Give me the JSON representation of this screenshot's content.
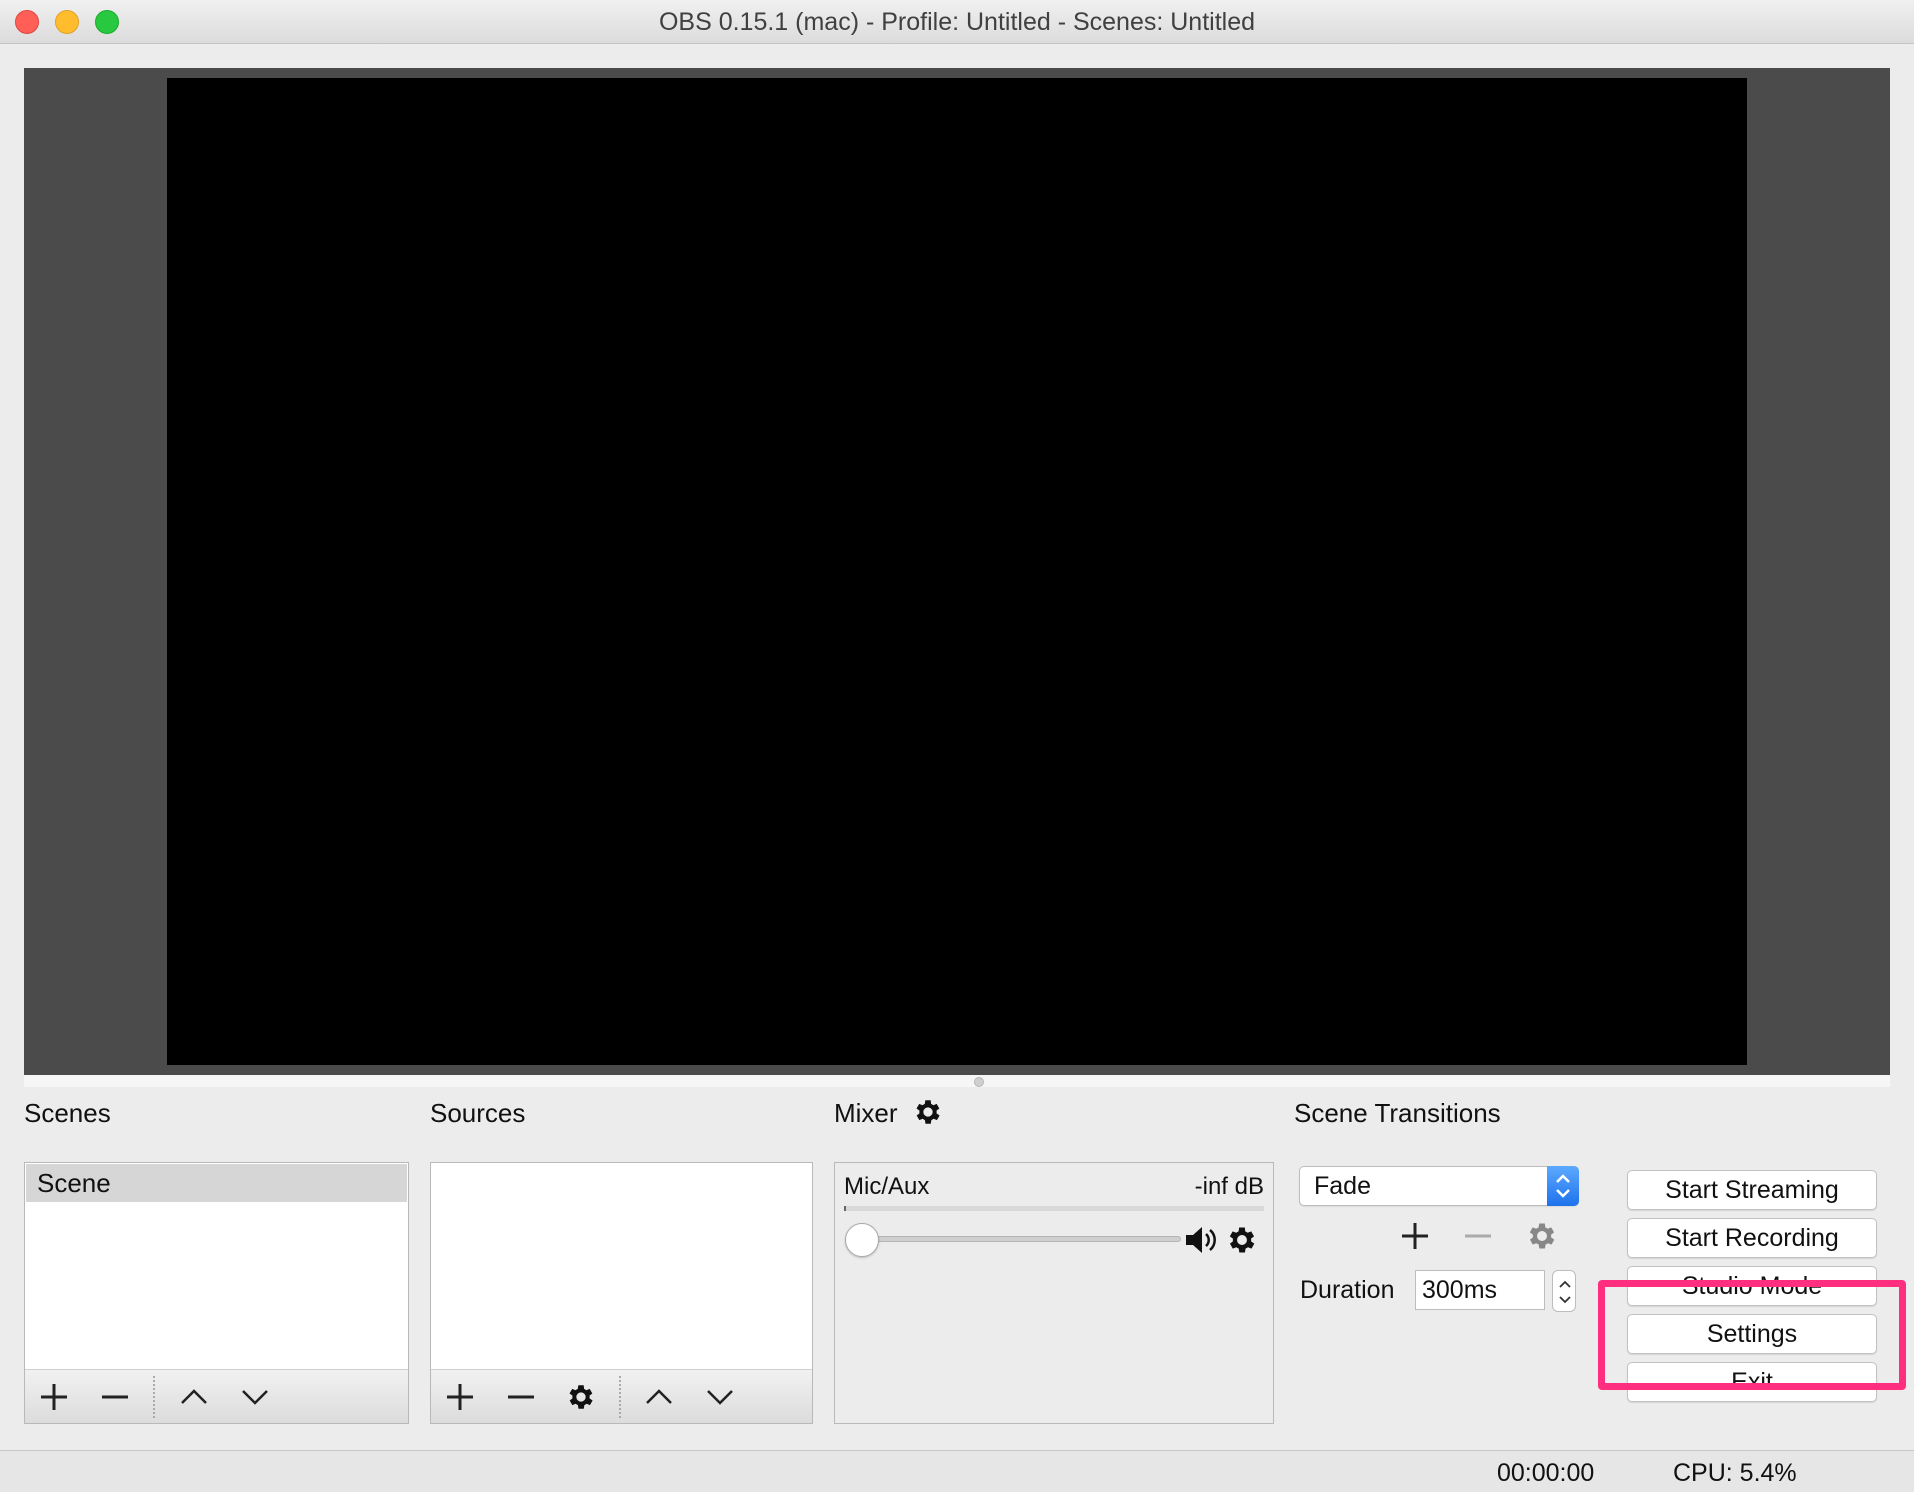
{
  "window": {
    "title": "OBS 0.15.1 (mac) - Profile: Untitled - Scenes: Untitled"
  },
  "docks": {
    "scenes_title": "Scenes",
    "sources_title": "Sources",
    "mixer_title": "Mixer",
    "transitions_title": "Scene Transitions"
  },
  "scenes": {
    "items": [
      {
        "label": "Scene",
        "selected": true
      }
    ]
  },
  "sources": {
    "items": []
  },
  "mixer": {
    "channel_name": "Mic/Aux",
    "level": "-inf dB",
    "volume_fraction": 0.0
  },
  "transitions": {
    "selected": "Fade",
    "duration_label": "Duration",
    "duration_value": "300ms"
  },
  "controls": {
    "start_streaming": "Start Streaming",
    "start_recording": "Start Recording",
    "studio_mode": "Studio Mode",
    "settings": "Settings",
    "exit": "Exit"
  },
  "status": {
    "time": "00:00:00",
    "cpu": "CPU: 5.4%"
  },
  "colors": {
    "highlight": "#ff2e7e",
    "select_accent": "#1d72ec",
    "preview_bg": "#000000"
  }
}
